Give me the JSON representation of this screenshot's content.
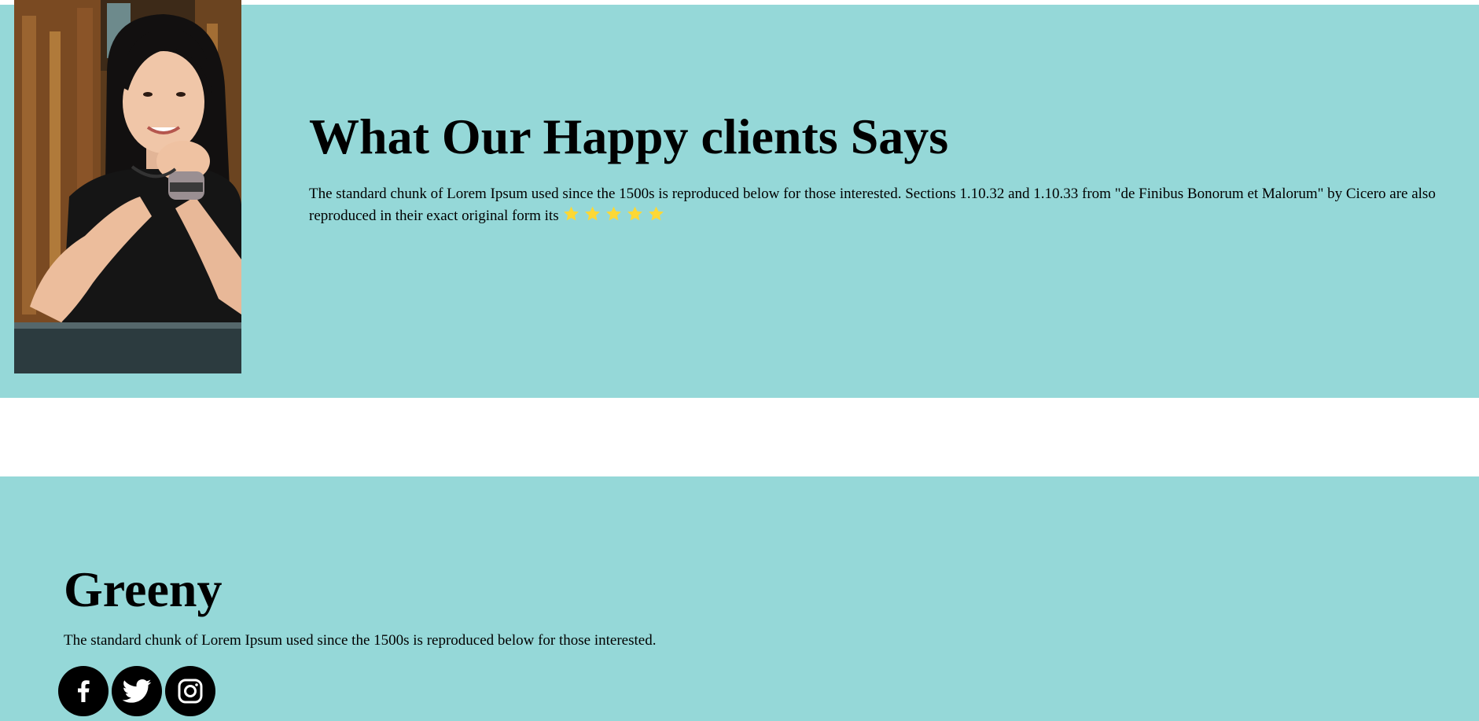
{
  "testimonial": {
    "title": "What Our Happy clients Says",
    "text": "The standard chunk of Lorem Ipsum used since the 1500s is reproduced below for those interested. Sections 1.10.32 and 1.10.33 from \"de Finibus Bonorum et Malorum\" by Cicero are also reproduced in their exact original form its",
    "rating": 5,
    "rating_max": 5,
    "star_color": "#fdd835"
  },
  "footer": {
    "brand": "Greeny",
    "tagline": "The standard chunk of Lorem Ipsum used since the 1500s is reproduced below for those interested.",
    "socials": [
      {
        "icon": "facebook-icon"
      },
      {
        "icon": "twitter-icon"
      },
      {
        "icon": "instagram-icon"
      }
    ]
  },
  "colors": {
    "section_bg": "#95d8d8",
    "page_bg": "#ffffff",
    "icon_bg": "#000000"
  }
}
